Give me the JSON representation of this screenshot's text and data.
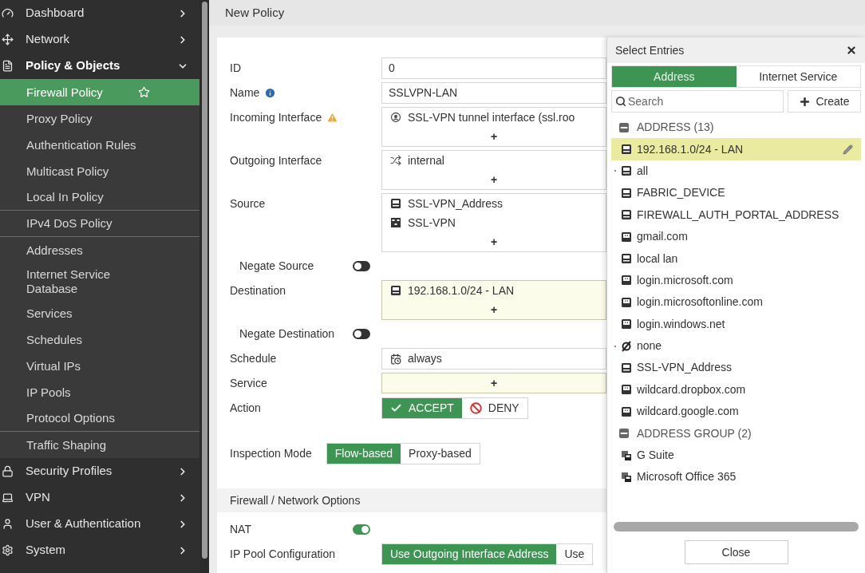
{
  "sidebar": {
    "items": [
      {
        "kind": "section",
        "label": "Dashboard",
        "expanded": false
      },
      {
        "kind": "section",
        "label": "Network",
        "expanded": false
      },
      {
        "kind": "section",
        "label": "Policy & Objects",
        "expanded": true
      },
      {
        "kind": "item",
        "label": "Firewall Policy",
        "selected": true,
        "divider_below": false
      },
      {
        "kind": "item",
        "label": "Proxy Policy",
        "selected": false,
        "divider_below": false
      },
      {
        "kind": "item",
        "label": "Authentication Rules",
        "selected": false,
        "divider_below": false
      },
      {
        "kind": "item",
        "label": "Multicast Policy",
        "selected": false,
        "divider_below": false
      },
      {
        "kind": "item",
        "label": "Local In Policy",
        "selected": false,
        "divider_below": true
      },
      {
        "kind": "item",
        "label": "IPv4 DoS Policy",
        "selected": false,
        "divider_below": true
      },
      {
        "kind": "item",
        "label": "Addresses",
        "selected": false,
        "divider_below": false
      },
      {
        "kind": "item",
        "label": "Internet Service Database",
        "selected": false,
        "divider_below": false
      },
      {
        "kind": "item",
        "label": "Services",
        "selected": false,
        "divider_below": false
      },
      {
        "kind": "item",
        "label": "Schedules",
        "selected": false,
        "divider_below": false
      },
      {
        "kind": "item",
        "label": "Virtual IPs",
        "selected": false,
        "divider_below": false
      },
      {
        "kind": "item",
        "label": "IP Pools",
        "selected": false,
        "divider_below": false
      },
      {
        "kind": "item",
        "label": "Protocol Options",
        "selected": false,
        "divider_below": true
      },
      {
        "kind": "item",
        "label": "Traffic Shaping",
        "selected": false,
        "divider_below": false
      },
      {
        "kind": "section",
        "label": "Security Profiles",
        "expanded": false
      },
      {
        "kind": "section",
        "label": "VPN",
        "expanded": false
      },
      {
        "kind": "section",
        "label": "User & Authentication",
        "expanded": false
      },
      {
        "kind": "section",
        "label": "System",
        "expanded": false
      }
    ]
  },
  "page": {
    "title": "New Policy"
  },
  "form": {
    "rows": [
      {
        "kind": "input",
        "label": "ID",
        "value": "0"
      },
      {
        "kind": "input",
        "label": "Name",
        "has_info": true,
        "value": "SSLVPN-LAN"
      },
      {
        "kind": "entries",
        "label": "Incoming Interface",
        "has_warning": true,
        "highlighted": false,
        "add": "+",
        "entries": [
          {
            "kind": "tunnel",
            "text": "SSL-VPN tunnel interface (ssl.roo"
          }
        ]
      },
      {
        "kind": "entries",
        "label": "Outgoing Interface",
        "highlighted": false,
        "add": "+",
        "entries": [
          {
            "kind": "port",
            "text": "internal"
          }
        ]
      },
      {
        "kind": "entries",
        "label": "Source",
        "highlighted": false,
        "add": "+",
        "entries": [
          {
            "kind": "address",
            "text": "SSL-VPN_Address"
          },
          {
            "kind": "usergroup",
            "text": "SSL-VPN"
          }
        ]
      },
      {
        "kind": "toggle",
        "label": "Negate Source",
        "nested": true,
        "on": false
      },
      {
        "kind": "entries",
        "label": "Destination",
        "highlighted": true,
        "add": "+",
        "entries": [
          {
            "kind": "address",
            "text": "192.168.1.0/24 - LAN"
          }
        ]
      },
      {
        "kind": "toggle",
        "label": "Negate Destination",
        "nested": true,
        "on": false
      },
      {
        "kind": "select",
        "label": "Schedule",
        "value": "always"
      },
      {
        "kind": "entries",
        "label": "Service",
        "highlighted": true,
        "add": "+"
      },
      {
        "kind": "choice",
        "label": "Action",
        "options": [
          {
            "kind": "accept",
            "text": "ACCEPT",
            "selected": true
          },
          {
            "kind": "deny",
            "text": "DENY",
            "selected": false
          }
        ]
      },
      {
        "kind": "choice",
        "label": "Inspection Mode",
        "inline": true,
        "options": [
          {
            "text": "Flow-based",
            "selected": true
          },
          {
            "text": "Proxy-based",
            "selected": false
          }
        ]
      },
      {
        "kind": "section",
        "label": "Firewall / Network Options"
      },
      {
        "kind": "toggle",
        "label": "NAT",
        "nested": false,
        "on": true
      },
      {
        "kind": "choice",
        "label": "IP Pool Configuration",
        "options": [
          {
            "text": "Use Outgoing Interface Address",
            "selected": true
          },
          {
            "text": "Use",
            "selected": false
          }
        ]
      }
    ]
  },
  "select_entries": {
    "title": "Select Entries",
    "tabs": [
      {
        "label": "Address",
        "selected": true
      },
      {
        "label": "Internet Service",
        "selected": false
      }
    ],
    "search": {
      "placeholder": "Search"
    },
    "create_button": "Create",
    "groups": [
      {
        "title": "ADDRESS (13)",
        "expanded": true,
        "items": [
          {
            "kind": "address",
            "text": "192.168.1.0/24 - LAN",
            "selected": true,
            "marked": false
          },
          {
            "kind": "address",
            "text": "all",
            "selected": false,
            "marked": true
          },
          {
            "kind": "address",
            "text": "FABRIC_DEVICE",
            "selected": false,
            "marked": false
          },
          {
            "kind": "address",
            "text": "FIREWALL_AUTH_PORTAL_ADDRESS",
            "selected": false,
            "marked": false
          },
          {
            "kind": "fqdn",
            "text": "gmail.com",
            "selected": false,
            "marked": false
          },
          {
            "kind": "address",
            "text": "local lan",
            "selected": false,
            "marked": false
          },
          {
            "kind": "fqdn",
            "text": "login.microsoft.com",
            "selected": false,
            "marked": false
          },
          {
            "kind": "fqdn",
            "text": "login.microsoftonline.com",
            "selected": false,
            "marked": false
          },
          {
            "kind": "fqdn",
            "text": "login.windows.net",
            "selected": false,
            "marked": false
          },
          {
            "kind": "none",
            "text": "none",
            "selected": false,
            "marked": true
          },
          {
            "kind": "address",
            "text": "SSL-VPN_Address",
            "selected": false,
            "marked": false
          },
          {
            "kind": "fqdn",
            "text": "wildcard.dropbox.com",
            "selected": false,
            "marked": false
          },
          {
            "kind": "fqdn",
            "text": "wildcard.google.com",
            "selected": false,
            "marked": false
          }
        ]
      },
      {
        "title": "ADDRESS GROUP (2)",
        "expanded": true,
        "items": [
          {
            "kind": "group",
            "text": "G Suite",
            "selected": false,
            "marked": false
          },
          {
            "kind": "group",
            "text": "Microsoft Office 365",
            "selected": false,
            "marked": false
          }
        ]
      }
    ],
    "close_button": "Close"
  }
}
